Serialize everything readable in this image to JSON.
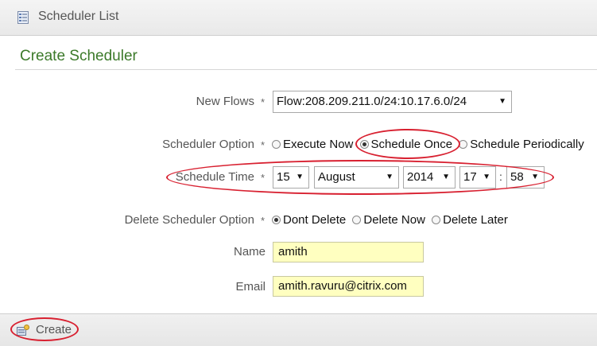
{
  "header": {
    "title": "Scheduler List",
    "icon": "list-icon"
  },
  "section": {
    "title": "Create Scheduler"
  },
  "form": {
    "new_flows": {
      "label": "New Flows",
      "required": "*",
      "value": "Flow:208.209.211.0/24:10.17.6.0/24"
    },
    "scheduler_option": {
      "label": "Scheduler Option",
      "required": "*",
      "options": [
        "Execute Now",
        "Schedule Once",
        "Schedule Periodically"
      ],
      "selected": "Schedule Once"
    },
    "schedule_time": {
      "label": "Schedule Time",
      "required": "*",
      "day": "15",
      "month": "August",
      "year": "2014",
      "hour": "17",
      "separator": ":",
      "minute": "58"
    },
    "delete_option": {
      "label": "Delete Scheduler Option",
      "required": "*",
      "options": [
        "Dont Delete",
        "Delete Now",
        "Delete Later"
      ],
      "selected": "Dont Delete"
    },
    "name": {
      "label": "Name",
      "value": "amith"
    },
    "email": {
      "label": "Email",
      "value": "amith.ravuru@citrix.com"
    }
  },
  "footer": {
    "create_label": "Create",
    "icon": "create-icon"
  },
  "colors": {
    "highlight": "#d82030",
    "title_green": "#3c7a2a",
    "input_yellow": "#ffffc0"
  }
}
